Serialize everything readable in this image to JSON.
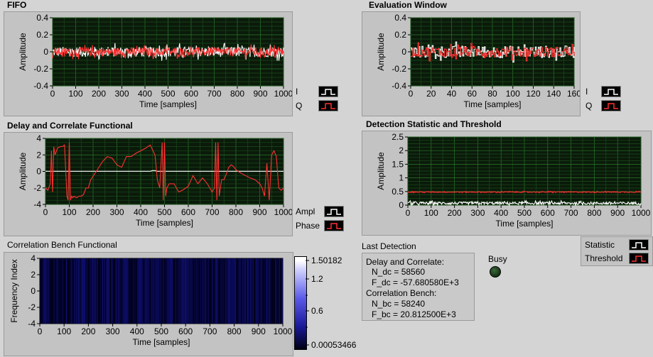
{
  "fifo": {
    "title": "FIFO",
    "ylabel": "Amplitude",
    "xlabel": "Time [samples]",
    "legend": [
      {
        "name": "I",
        "color": "#ffffff"
      },
      {
        "name": "Q",
        "color": "#ff3030"
      }
    ]
  },
  "evaluation": {
    "title": "Evaluation Window",
    "ylabel": "Amplitude",
    "xlabel": "Time [samples]",
    "legend": [
      {
        "name": "I",
        "color": "#ffffff"
      },
      {
        "name": "Q",
        "color": "#ff3030"
      }
    ]
  },
  "delay_correlate": {
    "title": "Delay and Correlate Functional",
    "ylabel": "Amplitude",
    "xlabel": "Time [samples]",
    "legend": [
      {
        "name": "Ampl",
        "color": "#ffffff"
      },
      {
        "name": "Phase",
        "color": "#ff3030"
      }
    ]
  },
  "detection": {
    "title": "Detection Statistic and Threshold",
    "ylabel": "Amplitude",
    "xlabel": "Time [samples]",
    "legend": [
      {
        "name": "Statistic",
        "color": "#ffffff"
      },
      {
        "name": "Threshold",
        "color": "#ff3030"
      }
    ]
  },
  "bench": {
    "title": "Correlation Bench Functional",
    "ylabel": "Frequency Index",
    "xlabel": "Time [samples]",
    "colorbar": {
      "max": "1.50182",
      "mid1": "1.2",
      "mid2": "0.6",
      "min": "0.00053466"
    }
  },
  "last_detection": {
    "title": "Last Detection",
    "lines": [
      "Delay and Correlate:",
      "N_dc = 58560",
      "F_dc = -57.680580E+3",
      "Correlation Bench:",
      "N_bc = 58240",
      "F_bc = 20.812500E+3"
    ]
  },
  "busy": {
    "label": "Busy"
  },
  "chart_data": [
    {
      "type": "line",
      "title": "FIFO",
      "xlabel": "Time [samples]",
      "ylabel": "Amplitude",
      "xlim": [
        0,
        1000
      ],
      "ylim": [
        -0.4,
        0.4
      ],
      "xticks": [
        "0",
        "100",
        "200",
        "300",
        "400",
        "500",
        "600",
        "700",
        "800",
        "900",
        "1000"
      ],
      "yticks": [
        "0.4",
        "0.2",
        "0",
        "-0.2",
        "-0.4"
      ],
      "grid": true,
      "series": [
        {
          "name": "I",
          "color": "#ffffff",
          "kind": "noise",
          "n": 400,
          "mean": 0,
          "amp": 0.06
        },
        {
          "name": "Q",
          "color": "#ff3030",
          "kind": "noise",
          "n": 400,
          "mean": 0,
          "amp": 0.05
        }
      ]
    },
    {
      "type": "line",
      "title": "Evaluation Window",
      "xlabel": "Time [samples]",
      "ylabel": "Amplitude",
      "xlim": [
        0,
        160
      ],
      "ylim": [
        -0.4,
        0.4
      ],
      "xticks": [
        "0",
        "20",
        "40",
        "60",
        "80",
        "100",
        "120",
        "140",
        "160"
      ],
      "yticks": [
        "0.4",
        "0.2",
        "0",
        "-0.2",
        "-0.4"
      ],
      "grid": true,
      "series": [
        {
          "name": "I",
          "color": "#ffffff",
          "kind": "noise",
          "n": 160,
          "mean": 0,
          "amp": 0.07
        },
        {
          "name": "Q",
          "color": "#ff3030",
          "kind": "noise",
          "n": 160,
          "mean": 0,
          "amp": 0.06
        }
      ]
    },
    {
      "type": "line",
      "title": "Delay and Correlate Functional",
      "xlabel": "Time [samples]",
      "ylabel": "Amplitude",
      "xlim": [
        0,
        1000
      ],
      "ylim": [
        -4,
        4
      ],
      "xticks": [
        "0",
        "100",
        "200",
        "300",
        "400",
        "500",
        "600",
        "700",
        "800",
        "900",
        "1000"
      ],
      "yticks": [
        "4",
        "2",
        "0",
        "-2",
        "-4"
      ],
      "grid": true,
      "series": [
        {
          "name": "Ampl",
          "color": "#ffffff",
          "kind": "points",
          "x": [
            0,
            440,
            450,
            460,
            470,
            1000
          ],
          "y": [
            0.02,
            0.02,
            0.1,
            0.1,
            0.02,
            0.02
          ]
        },
        {
          "name": "Phase",
          "color": "#ff3030",
          "kind": "points",
          "x": [
            0,
            10,
            20,
            25,
            30,
            35,
            40,
            50,
            60,
            70,
            80,
            90,
            95,
            100,
            105,
            110,
            115,
            120,
            130,
            140,
            150,
            160,
            170,
            180,
            190,
            200,
            220,
            240,
            260,
            280,
            300,
            320,
            340,
            360,
            380,
            400,
            420,
            440,
            460,
            470,
            480,
            490,
            495,
            500,
            505,
            510,
            520,
            540,
            560,
            580,
            600,
            620,
            640,
            660,
            680,
            700,
            710,
            715,
            720,
            725,
            730,
            740,
            750,
            760,
            770,
            780,
            790,
            800,
            820,
            840,
            860,
            880,
            900,
            910,
            920,
            930,
            940,
            950,
            960,
            970,
            980,
            990,
            1000
          ],
          "y": [
            -2,
            -2.3,
            -1.5,
            2.5,
            -2.5,
            3,
            2,
            2.8,
            3,
            3,
            3.2,
            -3,
            -3.5,
            3.5,
            -3.5,
            -3,
            -3.2,
            -3,
            -3.2,
            -3,
            -3,
            -2.8,
            -2,
            -2,
            -1,
            -0.6,
            0.3,
            1.2,
            1.8,
            1.6,
            0.8,
            0.5,
            1.8,
            1.8,
            2.2,
            2.5,
            2.8,
            3.2,
            2,
            -1,
            -2,
            3.5,
            -3.5,
            3.5,
            -3,
            -2,
            -1.5,
            -1.5,
            -2.5,
            -2.2,
            -1.8,
            -0.5,
            -1.5,
            -0.8,
            -1.5,
            -2.5,
            -2,
            3.5,
            -3.5,
            3.5,
            -3,
            -1,
            -1,
            -0.3,
            0.5,
            0.8,
            0.6,
            0.2,
            -0.2,
            -0.5,
            -0.8,
            -1,
            -1.5,
            -2,
            -3,
            1,
            -3.5,
            2,
            2.5,
            1.8,
            -2,
            -2.3,
            -2
          ]
        }
      ]
    },
    {
      "type": "line",
      "title": "Detection Statistic and Threshold",
      "xlabel": "Time [samples]",
      "ylabel": "Amplitude",
      "xlim": [
        0,
        1000
      ],
      "ylim": [
        0,
        2.5
      ],
      "xticks": [
        "0",
        "100",
        "200",
        "300",
        "400",
        "500",
        "600",
        "700",
        "800",
        "900",
        "1000"
      ],
      "yticks": [
        "2.5",
        "2",
        "1.5",
        "1",
        "0.5",
        "0"
      ],
      "grid": true,
      "series": [
        {
          "name": "Statistic",
          "color": "#ffffff",
          "kind": "noise",
          "n": 400,
          "mean": 0.07,
          "amp": 0.05
        },
        {
          "name": "Threshold",
          "color": "#ff3030",
          "kind": "noise",
          "n": 400,
          "mean": 0.48,
          "amp": 0.02
        }
      ]
    },
    {
      "type": "heatmap",
      "title": "Correlation Bench Functional",
      "xlabel": "Time [samples]",
      "ylabel": "Frequency Index",
      "xlim": [
        0,
        1000
      ],
      "ylim": [
        -4,
        4
      ],
      "xticks": [
        "0",
        "100",
        "200",
        "300",
        "400",
        "500",
        "600",
        "700",
        "800",
        "900",
        "1000"
      ],
      "yticks": [
        "4",
        "2",
        "0",
        "-2",
        "-4"
      ],
      "zrange": [
        0.00053466,
        1.50182
      ],
      "columns": 250
    }
  ]
}
